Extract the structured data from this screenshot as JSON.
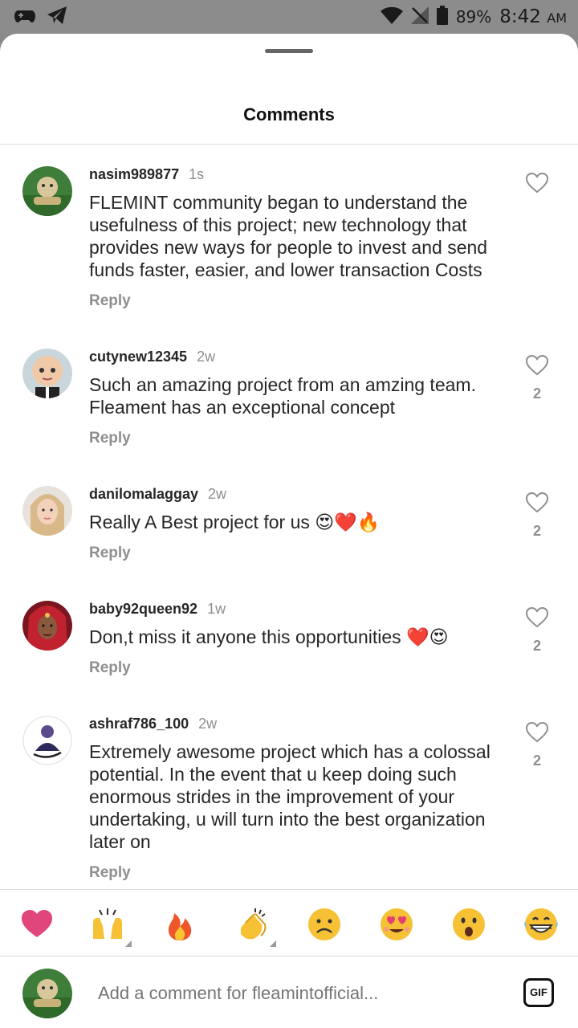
{
  "status_bar": {
    "battery": "89%",
    "time": "8:42",
    "ampm": "AM"
  },
  "header": {
    "title": "Comments"
  },
  "comments": [
    {
      "user": "nasim989877",
      "time": "1s",
      "text": "FLEMINT community began to understand the usefulness of this project; new technology that provides new ways for people to invest and send funds faster, easier, and lower transaction Costs",
      "reply": "Reply",
      "likes": ""
    },
    {
      "user": "cutynew12345",
      "time": "2w",
      "text": "Such an amazing project from an amzing team. Fleament has an exceptional concept",
      "reply": "Reply",
      "likes": "2"
    },
    {
      "user": "danilomalaggay",
      "time": "2w",
      "text": "Really A Best project for us 😍❤️🔥",
      "reply": "Reply",
      "likes": "2"
    },
    {
      "user": "baby92queen92",
      "time": "1w",
      "text": "Don,t miss it anyone this opportunities ❤️😍",
      "reply": "Reply",
      "likes": "2"
    },
    {
      "user": "ashraf786_100",
      "time": "2w",
      "text": "Extremely awesome project which has a colossal potential. In the event that u keep doing such enormous strides in the improvement of your undertaking, u will turn into the best organization later on",
      "reply": "Reply",
      "likes": "2"
    }
  ],
  "emoji_bar": [
    "heart",
    "raising-hands",
    "fire",
    "clapping-hands",
    "sad-face",
    "heart-eyes-face",
    "surprised-face",
    "grinning-face"
  ],
  "composer": {
    "placeholder": "Add a comment for fleamintofficial...",
    "gif_label": "GIF"
  }
}
